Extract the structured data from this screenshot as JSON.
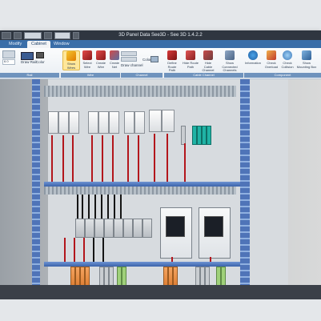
{
  "app": {
    "window_title": "3D Panel Data See3D - See 3D 1.4.2.2"
  },
  "tabs": [
    "Modify",
    "Cabinet",
    "Window"
  ],
  "active_tab": "Cabinet",
  "ribbon": {
    "left_controls": {
      "draw_rail_label": "Draw Rail",
      "color_label": "Color",
      "field_value": "6.0"
    },
    "buttons": [
      {
        "label": "Show Wires",
        "highlighted": true
      },
      {
        "label": "Select Wire",
        "highlighted": false
      },
      {
        "label": "Create Wire",
        "highlighted": false
      },
      {
        "label": "Create Net",
        "highlighted": false
      },
      {
        "label": "Draw channel",
        "highlighted": false
      },
      {
        "label": "Define Route Path",
        "highlighted": false
      },
      {
        "label": "Hide Route Path",
        "highlighted": false
      },
      {
        "label": "Hide Cable Channel",
        "highlighted": false
      },
      {
        "label": "Show Connected Channels",
        "highlighted": false
      },
      {
        "label": "Information",
        "highlighted": false
      },
      {
        "label": "Check Overload",
        "highlighted": false
      },
      {
        "label": "Check Collision",
        "highlighted": false
      },
      {
        "label": "Show Mounting Box",
        "highlighted": false
      }
    ],
    "group_labels": [
      "Rail",
      "Wire",
      "Channel",
      "Cable Channel",
      "Component"
    ],
    "color_label": "Color"
  },
  "colors": {
    "titlebar": "#2f3640",
    "tabbar": "#3a6ea8",
    "rail_blue": "#4f74b8",
    "wire_red": "#b3161c",
    "wire_black": "#151515"
  }
}
